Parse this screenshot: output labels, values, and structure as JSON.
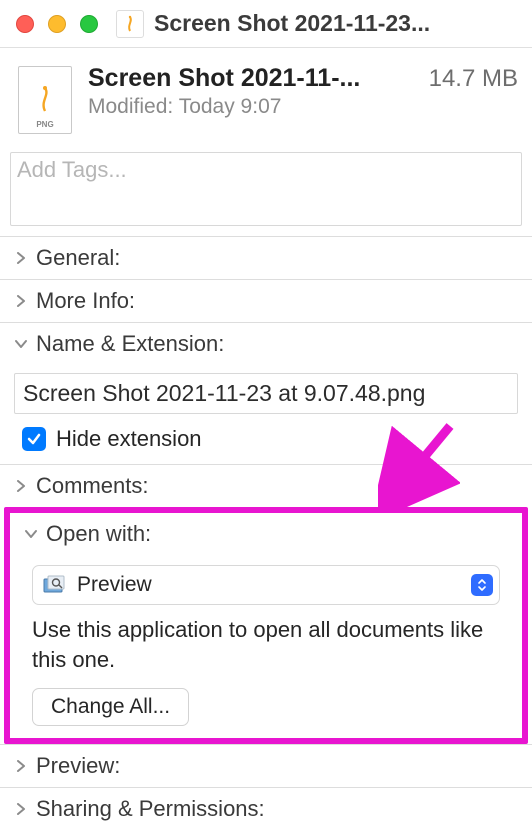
{
  "window": {
    "title": "Screen Shot 2021-11-23..."
  },
  "file": {
    "name": "Screen Shot 2021-11-...",
    "size": "14.7 MB",
    "modified_label": "Modified:",
    "modified_value": "Today 9:07",
    "type_label": "PNG"
  },
  "tags": {
    "placeholder": "Add Tags..."
  },
  "sections": {
    "general": "General:",
    "more_info": "More Info:",
    "name_ext": "Name & Extension:",
    "comments": "Comments:",
    "open_with": "Open with:",
    "preview": "Preview:",
    "sharing": "Sharing & Permissions:"
  },
  "name_ext": {
    "value": "Screen Shot 2021-11-23 at 9.07.48.png",
    "hide_ext_label": "Hide extension",
    "hide_ext_checked": true
  },
  "open_with": {
    "app": "Preview",
    "help": "Use this application to open all documents like this one.",
    "change_all": "Change All..."
  }
}
